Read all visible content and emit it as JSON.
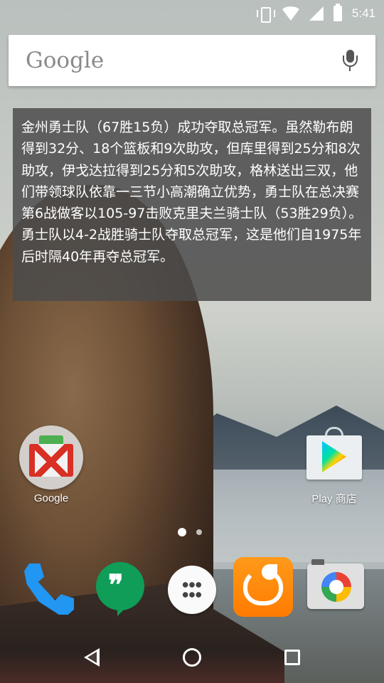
{
  "status_bar": {
    "icons": [
      "vibrate-icon",
      "wifi-icon",
      "cell-signal-icon",
      "battery-icon"
    ],
    "time": "5:41"
  },
  "search": {
    "logo_text": "Google",
    "mic_icon": "mic-icon"
  },
  "widget": {
    "text": "金州勇士队（67胜15负）成功夺取总冠军。虽然勒布朗得到32分、18个篮板和9次助攻，但库里得到25分和8次助攻，伊戈达拉得到25分和5次助攻，格林送出三双，他们带领球队依靠一三节小高潮确立优势，勇士队在总决赛第6战做客以105-97击败克里夫兰骑士队（53胜29负）。勇士队以4-2战胜骑士队夺取总冠军，这是他们自1975年后时隔40年再夺总冠军。"
  },
  "desktop": {
    "apps": [
      {
        "label": "Google",
        "icon": "gmail-folder-icon"
      },
      {
        "label": "Play 商店",
        "icon": "play-store-icon"
      }
    ],
    "page_indicator": {
      "pages": 2,
      "active": 1
    }
  },
  "dock": {
    "apps": [
      "phone-icon",
      "hangouts-icon",
      "all-apps-icon",
      "uc-browser-icon",
      "camera-icon"
    ]
  },
  "nav_bar": {
    "buttons": [
      "back-icon",
      "home-icon",
      "recents-icon"
    ]
  },
  "colors": {
    "widget_bg": "#4b4b4b",
    "phone": "#2196f3",
    "hangouts": "#0f9d58",
    "uc_browser": "#ff8c00"
  }
}
